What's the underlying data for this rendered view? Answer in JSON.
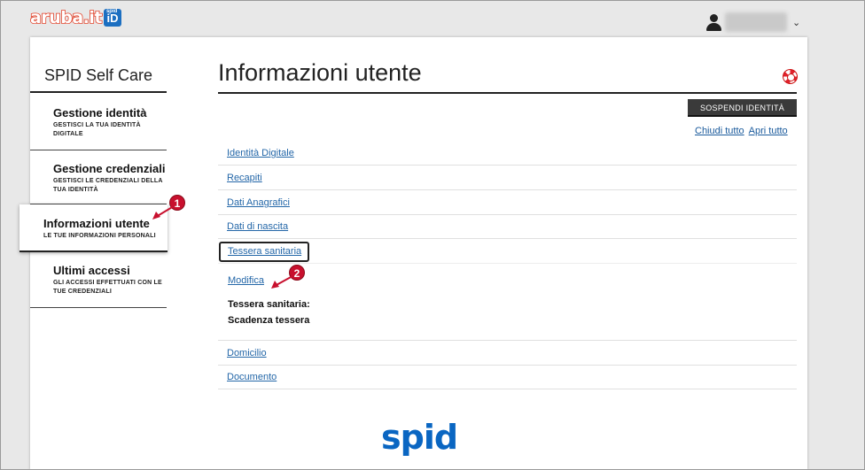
{
  "brand": {
    "logo_text": "aruba.it",
    "badge_small": "spid",
    "badge_main": "iD"
  },
  "user": {
    "menu_caret": "⌄"
  },
  "sidebar": {
    "title": "SPID Self Care",
    "items": [
      {
        "label": "Gestione identità",
        "sub": "GESTISCI LA TUA IDENTITÀ DIGITALE"
      },
      {
        "label": "Gestione credenziali",
        "sub": "GESTISCI LE CREDENZIALI DELLA TUA IDENTITÀ"
      },
      {
        "label": "Informazioni utente",
        "sub": "LE TUE INFORMAZIONI PERSONALI"
      },
      {
        "label": "Ultimi accessi",
        "sub": "GLI ACCESSI EFFETTUATI CON LE TUE CREDENZIALI"
      }
    ]
  },
  "main": {
    "title": "Informazioni utente",
    "suspend_button": "SOSPENDI IDENTITÀ",
    "collapse_all": "Chiudi tutto",
    "expand_all": "Apri tutto",
    "sections": [
      "Identità Digitale",
      "Recapiti",
      "Dati Anagrafici",
      "Dati di nascita",
      "Tessera sanitaria",
      "Domicilio",
      "Documento"
    ],
    "open_panel": {
      "edit_link": "Modifica",
      "field_1": "Tessera sanitaria:",
      "field_2": "Scadenza tessera"
    }
  },
  "footer": {
    "logo": "spid"
  },
  "annotations": {
    "marker_1": "1",
    "marker_2": "2"
  },
  "colors": {
    "accent": "#2467a8",
    "marker": "#c8102e",
    "spid_blue": "#0a66c2"
  }
}
